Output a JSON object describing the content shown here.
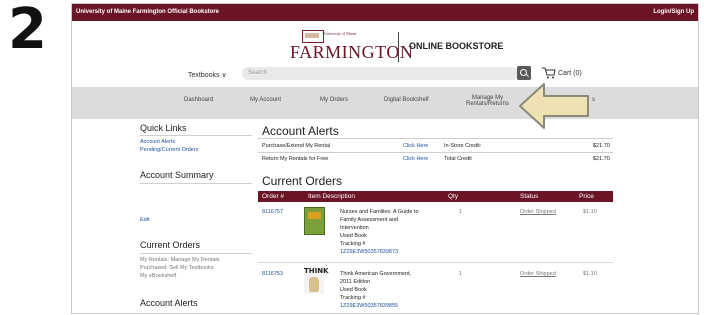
{
  "step_number": "2",
  "topbar": {
    "store_name": "University of Maine Farmington Official Bookstore",
    "login_label": "Login/Sign Up"
  },
  "logo": {
    "university_text": "University of Maine",
    "name": "FARMINGTON",
    "online_bookstore": "ONLINE BOOKSTORE"
  },
  "search": {
    "category_label": "Textbooks ∨",
    "placeholder": "Search"
  },
  "cart": {
    "label": "Cart (0)"
  },
  "nav": {
    "items": [
      "Dashboard",
      "My Account",
      "My Orders",
      "Digital Bookshelf",
      "Manage My",
      "Rentals/Returns",
      "s"
    ]
  },
  "sidebar": {
    "quick_links_title": "Quick Links",
    "quick_links": [
      "Account Alerts",
      "Pending/Current Orders"
    ],
    "account_summary_title": "Account Summary",
    "edit_label": "Edit",
    "current_orders_title": "Current Orders",
    "current_orders_text": [
      "My Rentals: Manage My Rentals",
      "Purchased: Sell My Textbooks",
      "My eBookshelf"
    ],
    "account_alerts_title": "Account Alerts"
  },
  "account_alerts": {
    "title": "Account Alerts",
    "rows": [
      {
        "label": "Purchase/Extend My Rental",
        "link": "Click Here"
      },
      {
        "label": "Return My Rentals for Free",
        "link": "Click Here"
      }
    ],
    "credits": [
      {
        "label": "In-Store Credit:",
        "value": "$21.70"
      },
      {
        "label": "Total Credit",
        "value": "$21.70"
      }
    ]
  },
  "current_orders": {
    "title": "Current Orders",
    "headers": [
      "Order #",
      "Item Description",
      "Qty",
      "Status",
      "Price"
    ],
    "rows": [
      {
        "order": "8116757",
        "description_lines": [
          "Nurses and Families: A Guide to",
          "Family Assessment and",
          "Intervention",
          "Used Book",
          "Tracking #"
        ],
        "tracking": "1Z29E3W50357839873",
        "qty": "1",
        "status": "Order Shipped",
        "price": "$1.10"
      },
      {
        "order": "8116753",
        "description_lines": [
          "Think American Government,",
          "2011 Edition",
          "Used Book",
          "Tracking #"
        ],
        "tracking": "1Z29E3W50357839855",
        "qty": "1",
        "status": "Order Shipped",
        "price": "$1.10",
        "thumb_text": "THINK"
      }
    ]
  },
  "colors": {
    "brand": "#6b1426",
    "link": "#1f4f9a",
    "nav_bg": "#dcdcdc",
    "arrow_fill": "#efe2b2",
    "arrow_stroke": "#8a8a7a"
  }
}
